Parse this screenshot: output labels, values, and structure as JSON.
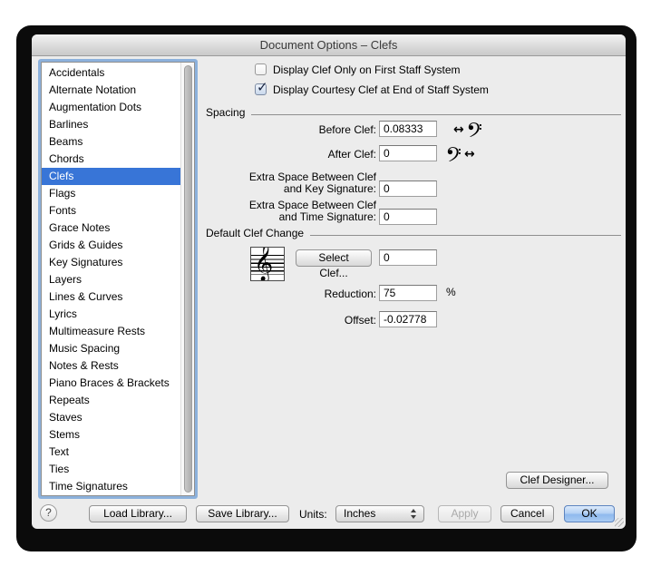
{
  "window": {
    "title": "Document Options – Clefs"
  },
  "sidebar": {
    "items": [
      "Accidentals",
      "Alternate Notation",
      "Augmentation Dots",
      "Barlines",
      "Beams",
      "Chords",
      "Clefs",
      "Flags",
      "Fonts",
      "Grace Notes",
      "Grids & Guides",
      "Key Signatures",
      "Layers",
      "Lines & Curves",
      "Lyrics",
      "Multimeasure Rests",
      "Music Spacing",
      "Notes & Rests",
      "Piano Braces & Brackets",
      "Repeats",
      "Staves",
      "Stems",
      "Text",
      "Ties",
      "Time Signatures"
    ],
    "selected": "Clefs"
  },
  "checkboxes": [
    {
      "label": "Display Clef Only on First Staff System",
      "checked": false
    },
    {
      "label": "Display Courtesy Clef at End of Staff System",
      "checked": true
    }
  ],
  "spacing": {
    "header": "Spacing",
    "before_clef": {
      "label": "Before Clef:",
      "value": "0.08333"
    },
    "after_clef": {
      "label": "After Clef:",
      "value": "0"
    },
    "extra_key": {
      "label_line1": "Extra Space Between Clef",
      "label_line2": "and Key Signature:",
      "value": "0"
    },
    "extra_time": {
      "label_line1": "Extra Space Between Clef",
      "label_line2": "and Time Signature:",
      "value": "0"
    }
  },
  "default_clef_change": {
    "header": "Default Clef Change",
    "select_clef_button": "Select Clef...",
    "clef_number": "0",
    "reduction": {
      "label": "Reduction:",
      "value": "75",
      "unit": "%"
    },
    "offset": {
      "label": "Offset:",
      "value": "-0.02778"
    }
  },
  "clef_designer_button": "Clef Designer...",
  "footer": {
    "help": "?",
    "load_library": "Load Library...",
    "save_library": "Save Library...",
    "units_label": "Units:",
    "units_value": "Inches",
    "apply": "Apply",
    "apply_enabled": false,
    "cancel": "Cancel",
    "ok": "OK"
  },
  "icons": {
    "left_right_arrow": "↔",
    "bass_clef": "bass-clef",
    "treble_clef": "𝄞",
    "checkmark": "✓",
    "units_stepper": "up-down-arrows",
    "help": "question-mark"
  },
  "colors": {
    "dialog_bg": "#ececec",
    "selection_blue": "#3875d7",
    "focus_ring": "#7ba7d9",
    "ok_button_blue": "#8fbaee",
    "titlebar_top": "#f3f3f3",
    "titlebar_bottom": "#c9c9c9"
  }
}
